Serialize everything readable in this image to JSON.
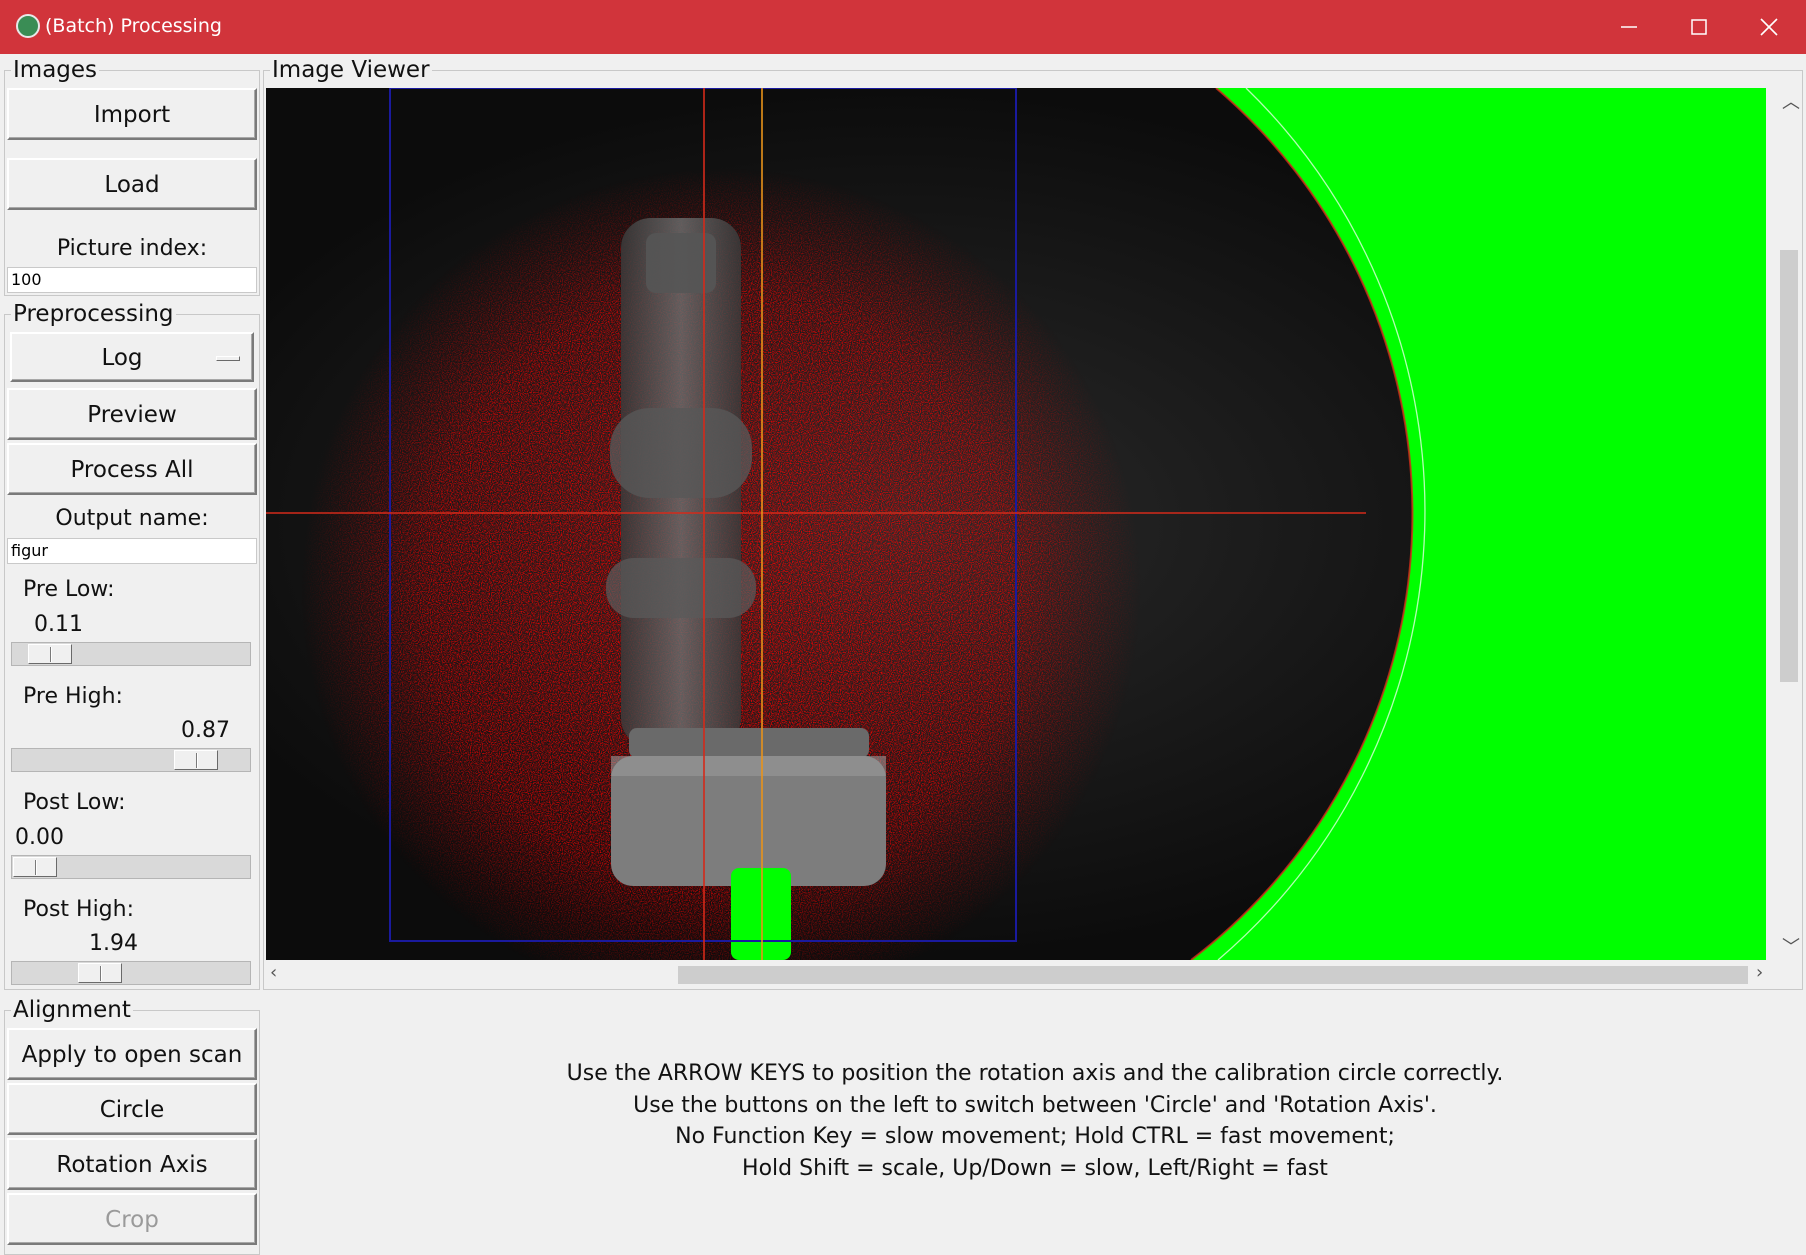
{
  "window": {
    "title": "(Batch) Processing",
    "icon": "app-logo-icon",
    "controls": {
      "minimize": "minimize-icon",
      "maximize": "maximize-icon",
      "close": "close-icon"
    }
  },
  "images": {
    "title": "Images",
    "import_label": "Import",
    "load_label": "Load",
    "picture_index_label": "Picture index:",
    "picture_index_value": "100"
  },
  "preprocessing": {
    "title": "Preprocessing",
    "method_selected": "Log",
    "preview_label": "Preview",
    "process_all_label": "Process All",
    "output_name_label": "Output name:",
    "output_name_value": "figur",
    "pre_low": {
      "label": "Pre Low:",
      "value": "0.11",
      "fraction": 0.08
    },
    "pre_high": {
      "label": "Pre High:",
      "value": "0.87",
      "fraction": 0.84
    },
    "post_low": {
      "label": "Post Low:",
      "value": "0.00",
      "fraction": 0.0
    },
    "post_high": {
      "label": "Post High:",
      "value": "1.94",
      "fraction": 0.34
    }
  },
  "alignment": {
    "title": "Alignment",
    "apply_label": "Apply to open scan",
    "circle_label": "Circle",
    "rotation_axis_label": "Rotation Axis",
    "crop_label": "Crop"
  },
  "viewer": {
    "title": "Image Viewer",
    "mask_color": "#00ff00",
    "crosshair_color": "#d42a1a",
    "axis_color": "#e8931a",
    "crop_color": "#1a1a9e"
  },
  "instructions": [
    "Use the ARROW KEYS to position the rotation axis and the calibration circle correctly.",
    "Use the buttons on the left to switch between 'Circle' and 'Rotation Axis'.",
    "No Function Key = slow movement; Hold CTRL = fast movement;",
    "Hold Shift = scale, Up/Down = slow, Left/Right = fast"
  ]
}
